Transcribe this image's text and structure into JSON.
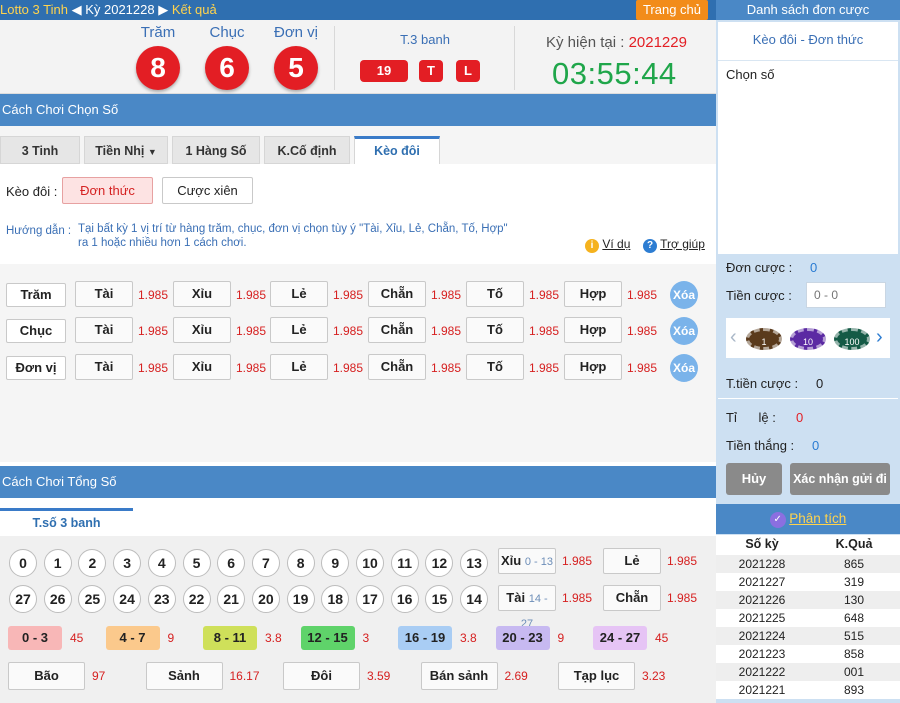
{
  "breadcrumb": {
    "a": "Lotto 3 Tinh",
    "b": "Kỳ 2021228",
    "c": "Kết quả"
  },
  "home": "Trang chủ",
  "result": {
    "digits": [
      {
        "label": "Trăm",
        "value": "8"
      },
      {
        "label": "Chục",
        "value": "6"
      },
      {
        "label": "Đơn vị",
        "value": "5"
      }
    ],
    "t3": {
      "label": "T.3 banh",
      "sum": "19",
      "size": "T",
      "parity": "L"
    },
    "period_label": "Kỳ hiện tại :",
    "period": "2021229",
    "countdown": "03:55:44"
  },
  "sec1": "Cách Chơi Chọn Số",
  "tabs": [
    "3 Tinh",
    "Tiền Nhị",
    "1 Hàng Số",
    "K.Cố định",
    "Kèo đôi"
  ],
  "kd": {
    "label": "Kèo đôi :",
    "opt1": "Đơn thức",
    "opt2": "Cược xiên"
  },
  "guide": {
    "label": "Hướng dẫn :",
    "line1": "Tại bất kỳ 1 vị trí từ hàng trăm, chục, đơn vị chọn tùy ý \"Tài, Xỉu, Lẻ, Chẵn, Tố, Hợp\"",
    "line2": "ra 1 hoặc nhiều hơn 1 cách chơi.",
    "example": "Ví dụ",
    "help": "Trợ giúp"
  },
  "bet_rows": [
    {
      "label": "Trăm",
      "opts": [
        {
          "n": "Tài",
          "o": "1.985"
        },
        {
          "n": "Xỉu",
          "o": "1.985"
        },
        {
          "n": "Lẻ",
          "o": "1.985"
        },
        {
          "n": "Chẵn",
          "o": "1.985"
        },
        {
          "n": "Tố",
          "o": "1.985"
        },
        {
          "n": "Hợp",
          "o": "1.985"
        }
      ]
    },
    {
      "label": "Chục",
      "opts": [
        {
          "n": "Tài",
          "o": "1.985"
        },
        {
          "n": "Xỉu",
          "o": "1.985"
        },
        {
          "n": "Lẻ",
          "o": "1.985"
        },
        {
          "n": "Chẵn",
          "o": "1.985"
        },
        {
          "n": "Tố",
          "o": "1.985"
        },
        {
          "n": "Hợp",
          "o": "1.985"
        }
      ]
    },
    {
      "label": "Đơn vị",
      "opts": [
        {
          "n": "Tài",
          "o": "1.985"
        },
        {
          "n": "Xỉu",
          "o": "1.985"
        },
        {
          "n": "Lẻ",
          "o": "1.985"
        },
        {
          "n": "Chẵn",
          "o": "1.985"
        },
        {
          "n": "Tố",
          "o": "1.985"
        },
        {
          "n": "Hợp",
          "o": "1.985"
        }
      ]
    }
  ],
  "clear": "Xóa",
  "sec2": "Cách Chơi Tổng Số",
  "tab2": "T.số 3 banh",
  "nums_row1": [
    "0",
    "1",
    "2",
    "3",
    "4",
    "5",
    "6",
    "7",
    "8",
    "9",
    "10",
    "11",
    "12",
    "13"
  ],
  "nums_row2": [
    "27",
    "26",
    "25",
    "24",
    "23",
    "22",
    "21",
    "20",
    "19",
    "18",
    "17",
    "16",
    "15",
    "14"
  ],
  "xiu": {
    "name": "Xỉu",
    "range": "0 - 13",
    "odd": "1.985"
  },
  "tai": {
    "name": "Tài",
    "range": "14 - 27",
    "odd": "1.985"
  },
  "le": {
    "name": "Lẻ",
    "odd": "1.985"
  },
  "chan": {
    "name": "Chẵn",
    "odd": "1.985"
  },
  "ranges": [
    {
      "l": "0 - 3",
      "o": "45",
      "c": "#f8b7b7"
    },
    {
      "l": "4 - 7",
      "o": "9",
      "c": "#fbc98c"
    },
    {
      "l": "8 - 11",
      "o": "3.8",
      "c": "#cfe05a"
    },
    {
      "l": "12 - 15",
      "o": "3",
      "c": "#5fd36a"
    },
    {
      "l": "16 - 19",
      "o": "3.8",
      "c": "#a9cdf4"
    },
    {
      "l": "20 - 23",
      "o": "9",
      "c": "#c7b9f1"
    },
    {
      "l": "24 - 27",
      "o": "45",
      "c": "#e6c4f5"
    }
  ],
  "specials": [
    {
      "n": "Bão",
      "o": "97"
    },
    {
      "n": "Sảnh",
      "o": "16.17"
    },
    {
      "n": "Đôi",
      "o": "3.59"
    },
    {
      "n": "Bán sảnh",
      "o": "2.69"
    },
    {
      "n": "Tạp lục",
      "o": "3.23"
    }
  ],
  "right": {
    "title": "Danh sách đơn cược",
    "sub": "Kèo đôi - Đơn thức",
    "chosen": "Chọn số",
    "orders_label": "Đơn cược :",
    "orders": "0",
    "amount_label": "Tiền cược :",
    "amount_ph": "0 - 0",
    "chips": [
      "1",
      "10",
      "100"
    ],
    "total_label": "T.tiền cược :",
    "total": "0",
    "rate_label": "Tỉ      lệ :",
    "rate": "0",
    "win_label": "Tiền thắng :",
    "win": "0",
    "cancel": "Hủy",
    "confirm": "Xác nhận gửi đi",
    "analysis": "Phân tích",
    "th_period": "Số kỳ",
    "th_result": "K.Quả",
    "history": [
      [
        "2021228",
        "865"
      ],
      [
        "2021227",
        "319"
      ],
      [
        "2021226",
        "130"
      ],
      [
        "2021225",
        "648"
      ],
      [
        "2021224",
        "515"
      ],
      [
        "2021223",
        "858"
      ],
      [
        "2021222",
        "001"
      ],
      [
        "2021221",
        "893"
      ]
    ]
  }
}
